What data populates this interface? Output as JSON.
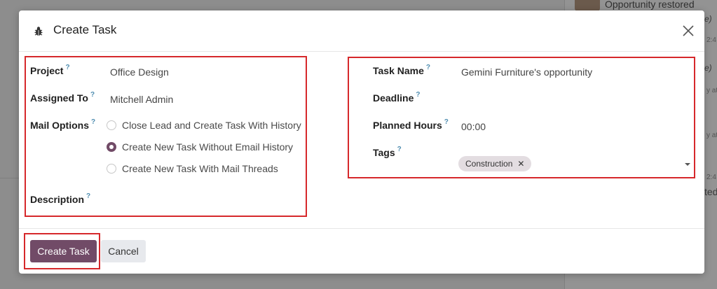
{
  "background": {
    "notification_text": "Opportunity restored",
    "fragments": [
      "e)",
      "e)",
      "ted",
      "2:4",
      "y at",
      "y at",
      "2:4"
    ]
  },
  "dialog": {
    "title": "Create Task",
    "icon": "bug-icon",
    "close_icon": "close-icon"
  },
  "left_fields": {
    "project": {
      "label": "Project",
      "help": "?",
      "value": "Office Design"
    },
    "assigned_to": {
      "label": "Assigned To",
      "help": "?",
      "value": "Mitchell Admin"
    },
    "mail_options": {
      "label": "Mail Options",
      "help": "?",
      "options": [
        {
          "label": "Close Lead and Create Task With History",
          "checked": false
        },
        {
          "label": "Create New Task Without Email History",
          "checked": true
        },
        {
          "label": "Create New Task With Mail Threads",
          "checked": false
        }
      ]
    },
    "description": {
      "label": "Description",
      "help": "?",
      "value": ""
    }
  },
  "right_fields": {
    "task_name": {
      "label": "Task Name",
      "help": "?",
      "value": "Gemini Furniture's opportunity"
    },
    "deadline": {
      "label": "Deadline",
      "help": "?",
      "value": ""
    },
    "planned_hours": {
      "label": "Planned Hours",
      "help": "?",
      "value": "00:00"
    },
    "tags": {
      "label": "Tags",
      "help": "?",
      "items": [
        "Construction"
      ],
      "remove_glyph": "✕"
    }
  },
  "footer": {
    "create_label": "Create Task",
    "cancel_label": "Cancel"
  },
  "colors": {
    "primary": "#714b67",
    "highlight_border": "#d6282b",
    "help_mark": "#4f8db0"
  }
}
